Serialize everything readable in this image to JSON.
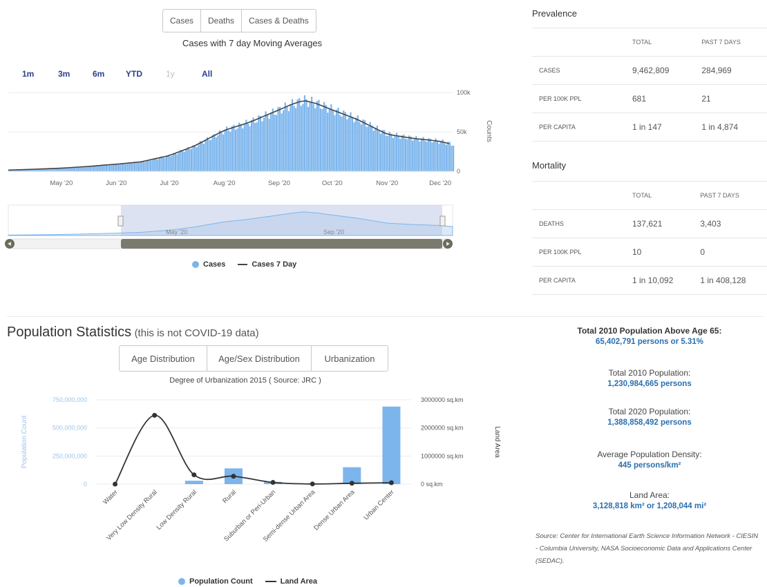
{
  "cases_panel": {
    "view_buttons": [
      "Cases",
      "Deaths",
      "Cases & Deaths"
    ],
    "chart_title": "Cases with 7 day Moving Averages",
    "range_buttons": [
      "1m",
      "3m",
      "6m",
      "YTD",
      "1y",
      "All"
    ],
    "legend": [
      "Cases",
      "Cases 7 Day"
    ],
    "navigator_labels": [
      "May '20",
      "Sep '20"
    ]
  },
  "prevalence": {
    "title": "Prevalence",
    "col_total": "TOTAL",
    "col_past": "PAST 7 DAYS",
    "rows": [
      {
        "label": "CASES",
        "total": "9,462,809",
        "past": "284,969"
      },
      {
        "label": "PER 100K PPL",
        "total": "681",
        "past": "21"
      },
      {
        "label": "PER CAPITA",
        "total": "1 in 147",
        "past": "1 in 4,874"
      }
    ]
  },
  "mortality": {
    "title": "Mortality",
    "col_total": "TOTAL",
    "col_past": "PAST 7 DAYS",
    "rows": [
      {
        "label": "DEATHS",
        "total": "137,621",
        "past": "3,403"
      },
      {
        "label": "PER 100K PPL",
        "total": "10",
        "past": "0"
      },
      {
        "label": "PER CAPITA",
        "total": "1 in 10,092",
        "past": "1 in 408,128"
      }
    ]
  },
  "population": {
    "title": "Population Statistics",
    "subtitle": "(this is not COVID-19 data)",
    "tabs": [
      "Age Distribution",
      "Age/Sex Distribution",
      "Urbanization"
    ],
    "chart_title": "Degree of Urbanization 2015 ( Source: JRC )",
    "legend": [
      "Population Count",
      "Land Area"
    ]
  },
  "stats": {
    "above65_label": "Total 2010 Population Above Age 65:",
    "above65_value": "65,402,791 persons or 5.31%",
    "pop2010_label": "Total 2010 Population:",
    "pop2010_value": "1,230,984,665 persons",
    "pop2020_label": "Total 2020 Population:",
    "pop2020_value": "1,388,858,492 persons",
    "density_label": "Average Population Density:",
    "density_value": "445 persons/km²",
    "land_label": "Land Area:",
    "land_value": "3,128,818 km² or 1,208,044 mi²",
    "source": "Source: Center for International Earth Science Information Network - CIESIN - Columbia University, NASA Socioeconomic Data and Applications Center (SEDAC)."
  },
  "colors": {
    "bar": "#7cb5ec",
    "line": "#434348",
    "link": "#2a6fb0",
    "range": "#2b3f8c"
  },
  "chart_data": [
    {
      "type": "bar",
      "title": "Cases with 7 day Moving Averages",
      "ylabel": "Counts",
      "x_ticks": [
        "May '20",
        "Jun '20",
        "Jul '20",
        "Aug '20",
        "Sep '20",
        "Oct '20",
        "Nov '20",
        "Dec '20"
      ],
      "y_ticks": [
        "0",
        "50k",
        "100k"
      ],
      "ylim": [
        0,
        100000
      ],
      "series": [
        {
          "name": "Cases",
          "type": "bar",
          "points": [
            [
              "2020-04-01",
              1500
            ],
            [
              "2020-04-15",
              2500
            ],
            [
              "2020-05-01",
              4000
            ],
            [
              "2020-05-15",
              6000
            ],
            [
              "2020-06-01",
              9000
            ],
            [
              "2020-06-15",
              12000
            ],
            [
              "2020-07-01",
              20000
            ],
            [
              "2020-07-15",
              32000
            ],
            [
              "2020-08-01",
              52000
            ],
            [
              "2020-08-15",
              62000
            ],
            [
              "2020-09-01",
              78000
            ],
            [
              "2020-09-08",
              85000
            ],
            [
              "2020-09-15",
              90000
            ],
            [
              "2020-09-22",
              86000
            ],
            [
              "2020-10-01",
              78000
            ],
            [
              "2020-10-15",
              66000
            ],
            [
              "2020-11-01",
              47000
            ],
            [
              "2020-11-15",
              42000
            ],
            [
              "2020-12-01",
              38000
            ],
            [
              "2020-12-08",
              34000
            ]
          ]
        },
        {
          "name": "Cases 7 Day",
          "type": "line",
          "points": [
            [
              "2020-04-01",
              1500
            ],
            [
              "2020-04-15",
              2500
            ],
            [
              "2020-05-01",
              4000
            ],
            [
              "2020-05-15",
              6000
            ],
            [
              "2020-06-01",
              9000
            ],
            [
              "2020-06-15",
              12000
            ],
            [
              "2020-07-01",
              20000
            ],
            [
              "2020-07-15",
              32000
            ],
            [
              "2020-08-01",
              52000
            ],
            [
              "2020-08-15",
              62000
            ],
            [
              "2020-09-01",
              78000
            ],
            [
              "2020-09-08",
              85000
            ],
            [
              "2020-09-15",
              90000
            ],
            [
              "2020-09-22",
              86000
            ],
            [
              "2020-10-01",
              78000
            ],
            [
              "2020-10-15",
              66000
            ],
            [
              "2020-11-01",
              47000
            ],
            [
              "2020-11-15",
              42000
            ],
            [
              "2020-12-01",
              38000
            ],
            [
              "2020-12-08",
              34000
            ]
          ]
        }
      ]
    },
    {
      "type": "bar",
      "title": "Degree of Urbanization 2015 ( Source: JRC )",
      "categories": [
        "Water",
        "Very Low Density Rural",
        "Low Density Rural",
        "Rural",
        "Suburban or Peri-Urban",
        "Semi-dense Urban Area",
        "Dense Urban Area",
        "Urban Center"
      ],
      "y_ticks_left": [
        "0",
        "250,000,000",
        "500,000,000",
        "750,000,000"
      ],
      "y_ticks_right": [
        "0 sq.km",
        "1000000 sq.km",
        "2000000 sq.km",
        "3000000 sq.km"
      ],
      "ylabel_left": "Population Count",
      "ylabel_right": "Land Area",
      "ylim_left": [
        0,
        750000000
      ],
      "ylim_right": [
        0,
        3000000
      ],
      "series": [
        {
          "name": "Population Count",
          "type": "bar",
          "axis": "left",
          "values": [
            0,
            0,
            30000000,
            140000000,
            20000000,
            5000000,
            150000000,
            690000000
          ]
        },
        {
          "name": "Land Area",
          "type": "line",
          "axis": "right",
          "values": [
            0,
            2450000,
            330000,
            280000,
            60000,
            5000,
            30000,
            50000
          ]
        }
      ]
    }
  ]
}
